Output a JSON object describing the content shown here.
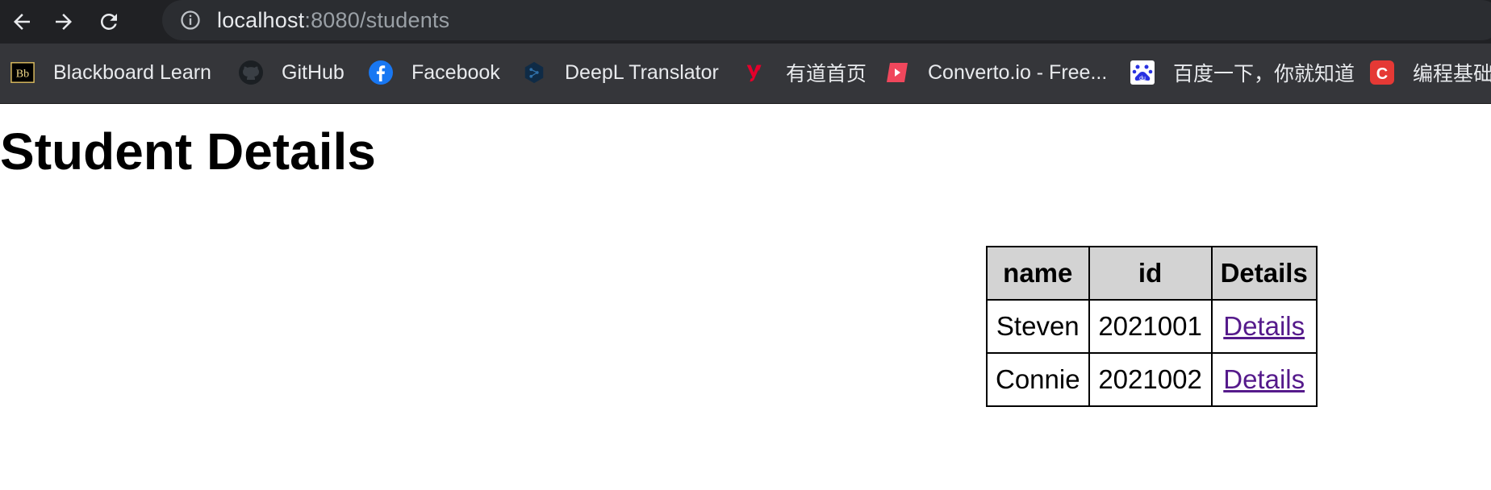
{
  "browser": {
    "url_host": "localhost",
    "url_rest": ":8080/students"
  },
  "bookmarks": [
    {
      "label": "Blackboard Learn",
      "icon": "blackboard-icon"
    },
    {
      "label": "GitHub",
      "icon": "github-icon"
    },
    {
      "label": "Facebook",
      "icon": "facebook-icon"
    },
    {
      "label": "DeepL Translator",
      "icon": "deepl-icon"
    },
    {
      "label": "有道首页",
      "icon": "youdao-icon"
    },
    {
      "label": "Converto.io - Free...",
      "icon": "converto-icon"
    },
    {
      "label": "百度一下，你就知道",
      "icon": "baidu-icon"
    },
    {
      "label": "编程基础",
      "icon": "c-icon"
    }
  ],
  "page": {
    "title": "Student Details"
  },
  "table": {
    "headers": [
      "name",
      "id",
      "Details"
    ],
    "rows": [
      {
        "name": "Steven",
        "id": "2021001",
        "link": "Details"
      },
      {
        "name": "Connie",
        "id": "2021002",
        "link": "Details"
      }
    ]
  },
  "colors": {
    "toolbar_bg": "#202124",
    "bookmarks_bg": "#35363a",
    "header_cell_bg": "#d3d3d3",
    "visited_link": "#551a8b"
  }
}
